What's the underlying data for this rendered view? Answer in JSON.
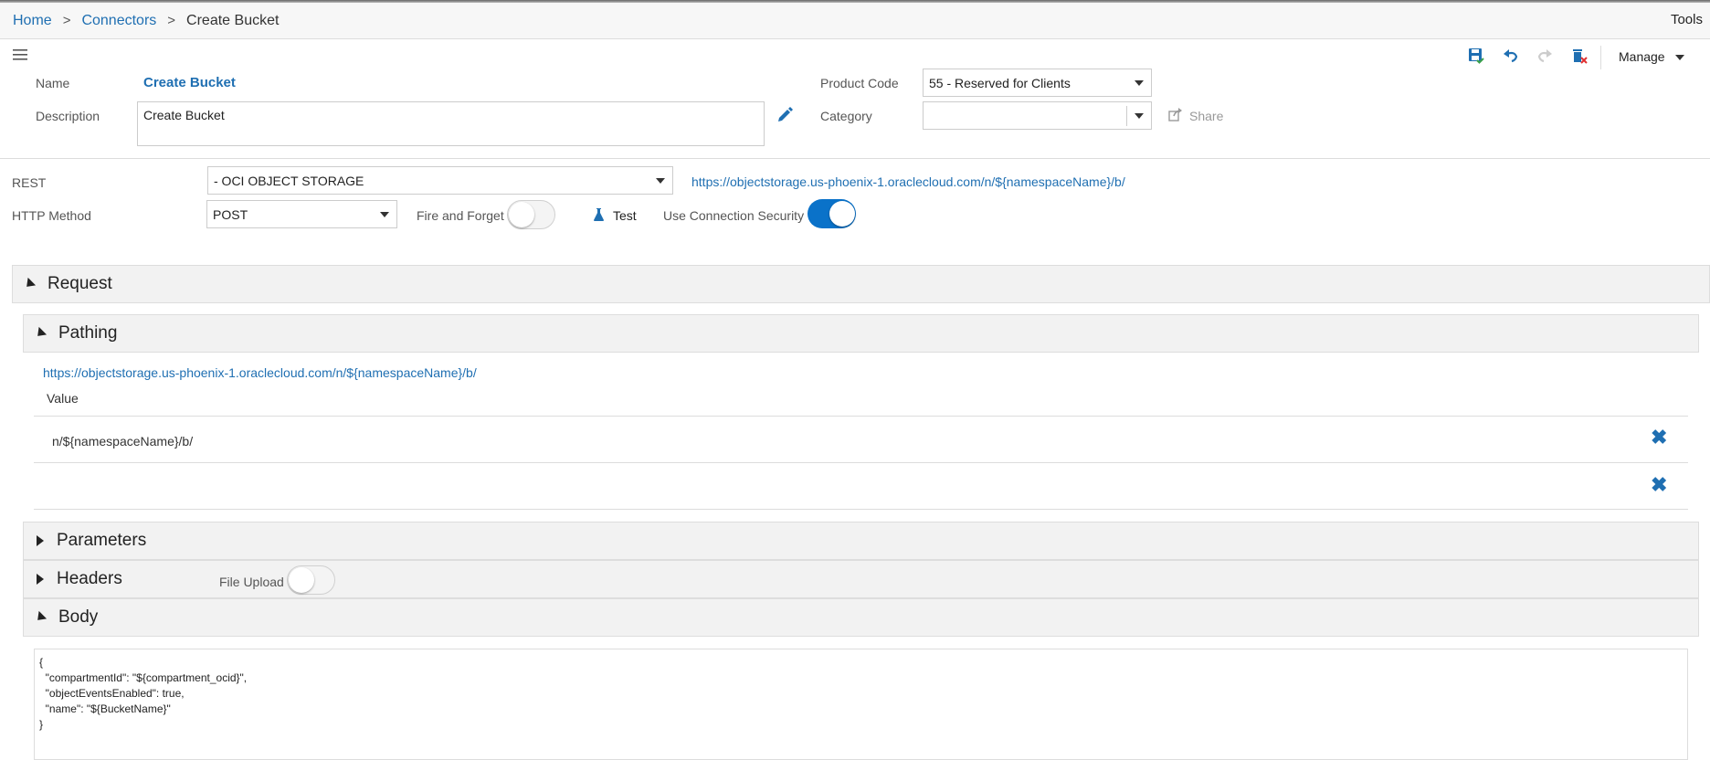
{
  "breadcrumb": {
    "home": "Home",
    "connectors": "Connectors",
    "current": "Create Bucket",
    "sep": ">"
  },
  "tools_label": "Tools",
  "toolbar": {
    "manage_label": "Manage"
  },
  "form": {
    "name_label": "Name",
    "name_value": "Create Bucket",
    "description_label": "Description",
    "description_value": "Create Bucket",
    "product_code_label": "Product Code",
    "product_code_value": "55 - Reserved for Clients",
    "category_label": "Category",
    "category_value": "",
    "share_label": "Share"
  },
  "rest": {
    "rest_label": "REST",
    "rest_value": "- OCI OBJECT STORAGE",
    "rest_url": "https://objectstorage.us-phoenix-1.oraclecloud.com/n/${namespaceName}/b/",
    "http_method_label": "HTTP Method",
    "http_method_value": "POST",
    "fire_and_forget_label": "Fire and Forget",
    "test_label": "Test",
    "use_connection_security_label": "Use Connection Security"
  },
  "request": {
    "title": "Request",
    "pathing": {
      "title": "Pathing",
      "url": "https://objectstorage.us-phoenix-1.oraclecloud.com/n/${namespaceName}/b/",
      "value_header": "Value",
      "rows": [
        "n/${namespaceName}/b/",
        ""
      ]
    },
    "parameters_title": "Parameters",
    "headers_title": "Headers",
    "file_upload_label": "File Upload",
    "body_title": "Body",
    "body_text": "{\n  \"compartmentId\": \"${compartment_ocid}\",\n  \"objectEventsEnabled\": true,\n  \"name\": \"${BucketName}\"\n}"
  },
  "colors": {
    "accent": "#1f6fb2",
    "toggle_on": "#0a72c9"
  },
  "icons": [
    "hamburger-icon",
    "save-icon",
    "undo-icon",
    "redo-icon",
    "delete-icon",
    "pencil-icon",
    "share-icon",
    "flask-icon",
    "close-icon"
  ]
}
